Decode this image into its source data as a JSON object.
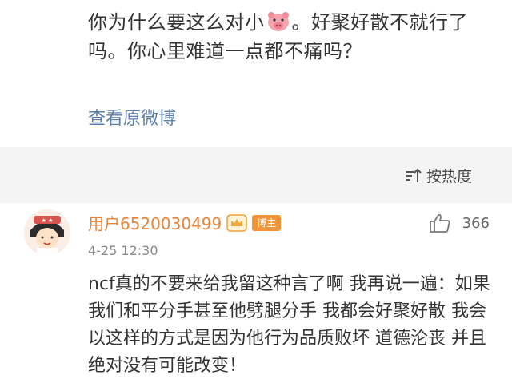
{
  "post": {
    "text_before_emoji": "你为什么要这么对小",
    "text_after_emoji": "。好聚好散不就行了吗。你心里难道一点都不痛吗？",
    "emoji_name": "pig-face-icon",
    "view_original_label": "查看原微博"
  },
  "sort": {
    "label": "按热度",
    "icon": "sort-icon"
  },
  "comment": {
    "username": "用户6520030499",
    "badge_label": "博主",
    "timestamp": "4-25 12:30",
    "like_count": "366",
    "text": "ncf真的不要来给我留这种言了啊 我再说一遍：如果我们和平分手甚至他劈腿分手 我都会好聚好散 我会以这样的方式是因为他行为品质败坏 道德沦丧 并且绝对没有可能改变！",
    "colors": {
      "username": "#e8843b",
      "badge": "#f0953a",
      "link": "#5c7fa8"
    }
  }
}
